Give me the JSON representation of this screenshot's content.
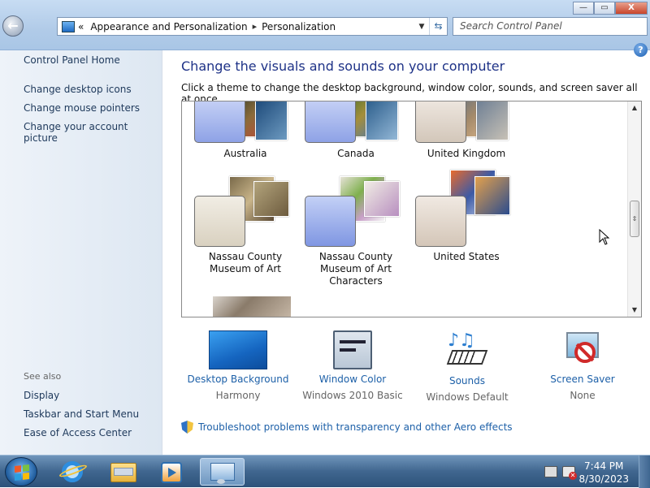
{
  "addressbar": {
    "overflow": "«",
    "crumbs": [
      "Appearance and Personalization",
      "Personalization"
    ],
    "search_placeholder": "Search Control Panel"
  },
  "window_buttons": {
    "minimize": "—",
    "maximize": "▭",
    "close": "X"
  },
  "leftnav": {
    "home": "Control Panel Home",
    "tasks": [
      "Change desktop icons",
      "Change mouse pointers",
      "Change your account picture"
    ],
    "see_also_label": "See also",
    "see_also": [
      "Display",
      "Taskbar and Start Menu",
      "Ease of Access Center"
    ]
  },
  "main": {
    "heading": "Change the visuals and sounds on your computer",
    "subheading": "Click a theme to change the desktop background, window color, sounds, and screen saver all at once.",
    "themes": [
      {
        "label_lines": [
          "Australia"
        ],
        "tint": "#a6b8ee"
      },
      {
        "label_lines": [
          "Canada"
        ],
        "tint": "#a6b8ee"
      },
      {
        "label_lines": [
          "United Kingdom"
        ],
        "tint": "#e2d8cf"
      },
      {
        "label_lines": [
          "Nassau County",
          "Museum of Art"
        ],
        "tint": "#e6e1d6"
      },
      {
        "label_lines": [
          "Nassau County",
          "Museum of Art",
          "Characters"
        ],
        "tint": "#9fb4ec"
      },
      {
        "label_lines": [
          "United States"
        ],
        "tint": "#e2d8cf"
      }
    ],
    "options": [
      {
        "label": "Desktop Background",
        "value": "Harmony"
      },
      {
        "label": "Window Color",
        "value": "Windows 2010 Basic"
      },
      {
        "label": "Sounds",
        "value": "Windows Default"
      },
      {
        "label": "Screen Saver",
        "value": "None"
      }
    ],
    "troubleshoot": "Troubleshoot problems with transparency and other Aero effects",
    "help_symbol": "?"
  },
  "taskbar": {
    "time": "7:44 PM",
    "date": "8/30/2023"
  }
}
